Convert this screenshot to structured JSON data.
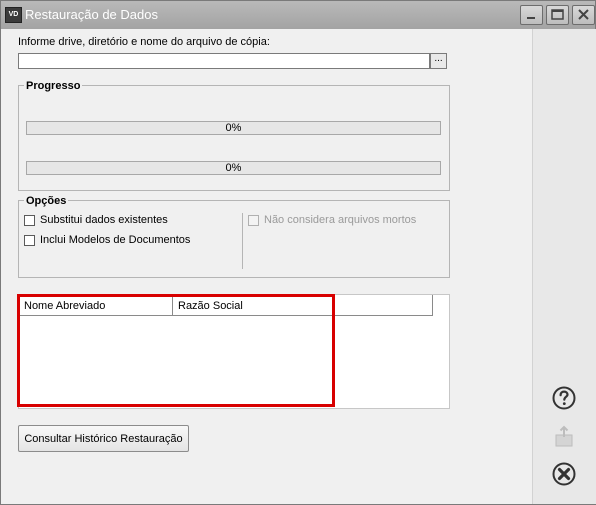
{
  "window": {
    "title": "Restauração de Dados",
    "icon_text": "VD",
    "controls": [
      "minimize-icon",
      "maximize-icon",
      "close-icon"
    ]
  },
  "path": {
    "label": "Informe drive, diretório e nome do arquivo de cópia:",
    "value": "",
    "browse_label": "..."
  },
  "progress": {
    "title": "Progresso",
    "bars": [
      {
        "percent": 0,
        "text": "0%"
      },
      {
        "percent": 0,
        "text": "0%"
      }
    ]
  },
  "options": {
    "title": "Opções",
    "left": [
      {
        "label": "Substitui dados existentes",
        "checked": false
      },
      {
        "label": "Inclui Modelos de Documentos",
        "checked": false
      }
    ],
    "right": [
      {
        "label": "Não considera arquivos mortos",
        "checked": false,
        "enabled": false
      }
    ]
  },
  "grid": {
    "columns": [
      "Nome Abreviado",
      "Razão Social"
    ],
    "rows": []
  },
  "history_button": "Consultar Histórico Restauração",
  "side_icons": [
    "help-icon",
    "export-icon",
    "close-circle-icon"
  ],
  "colors": {
    "highlight": "#d80000",
    "titlebar": "#a9a9a9"
  }
}
